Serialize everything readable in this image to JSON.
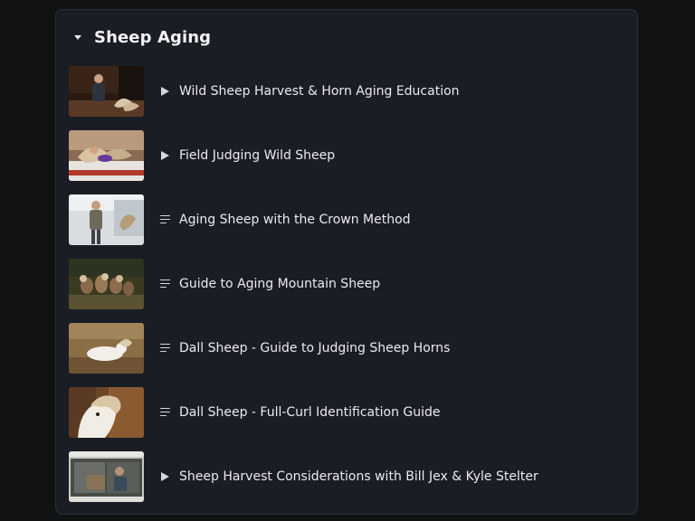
{
  "section": {
    "title": "Sheep Aging",
    "expanded": true
  },
  "items": [
    {
      "type_icon": "play-icon",
      "label": "Wild Sheep Harvest & Horn Aging Education",
      "thumb": "speaker presenting at event"
    },
    {
      "type_icon": "play-icon",
      "label": "Field Judging Wild Sheep",
      "thumb": "hands measuring sheep horn"
    },
    {
      "type_icon": "article-icon",
      "label": "Aging Sheep with the Crown Method",
      "thumb": "man with sheep horns"
    },
    {
      "type_icon": "article-icon",
      "label": "Guide to Aging Mountain Sheep",
      "thumb": "herd of bighorn sheep"
    },
    {
      "type_icon": "article-icon",
      "label": "Dall Sheep - Guide to Judging Sheep Horns",
      "thumb": "dall sheep resting"
    },
    {
      "type_icon": "article-icon",
      "label": "Dall Sheep - Full-Curl Identification Guide",
      "thumb": "dall ram head"
    },
    {
      "type_icon": "play-icon",
      "label": "Sheep Harvest Considerations with Bill Jex & Kyle Stelter",
      "thumb": "video call screenshot"
    }
  ]
}
